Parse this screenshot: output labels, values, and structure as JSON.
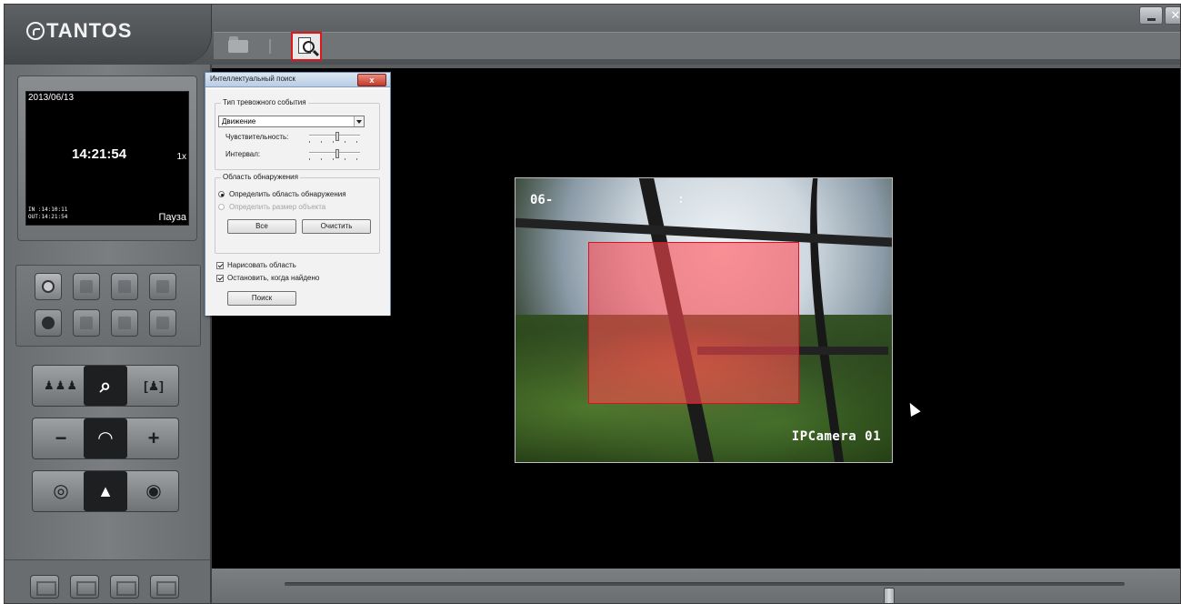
{
  "app": {
    "logo_text": "TANTOS",
    "toolbar": {
      "open_icon": "folder-icon",
      "search_icon": "search-document-icon",
      "highlight_color": "#e0161b"
    },
    "window_buttons": {
      "minimize": "_",
      "close": "✕"
    }
  },
  "preview": {
    "date": "2013/06/13",
    "time": "14:21:54",
    "speed": "1x",
    "in_time": "IN :14:10:11",
    "out_time": "OUT:14:21:54",
    "state": "Пауза"
  },
  "controls": {
    "zoom_minus": "−",
    "zoom_plus": "+",
    "tool_icons": [
      "clock-icon",
      "doc-icon",
      "eye-icon",
      "lock-icon",
      "gear-icon",
      "pen-icon",
      "print-icon",
      "save-icon"
    ]
  },
  "video": {
    "osd_left": "06-",
    "osd_colon": ":",
    "camera_name": "IPCamera 01",
    "region_color": "#ff4650"
  },
  "timeline": {
    "position": 0.72
  },
  "dialog": {
    "title": "Интеллектуальный поиск",
    "close_label": "x",
    "event_group": {
      "label": "Тип тревожного события",
      "event_type": "Движение",
      "sensitivity_label": "Чувствительность:",
      "sensitivity_value": 0.55,
      "interval_label": "Интервал:",
      "interval_value": 0.55
    },
    "area_group": {
      "label": "Область обнаружения",
      "define_area": "Определить область обнаружения",
      "define_size": "Определить размер объекта",
      "all_button": "Все",
      "clear_button": "Очистить"
    },
    "draw_area": "Нарисовать область",
    "stop_when_found": "Остановить, когда найдено",
    "search_button": "Поиск"
  }
}
